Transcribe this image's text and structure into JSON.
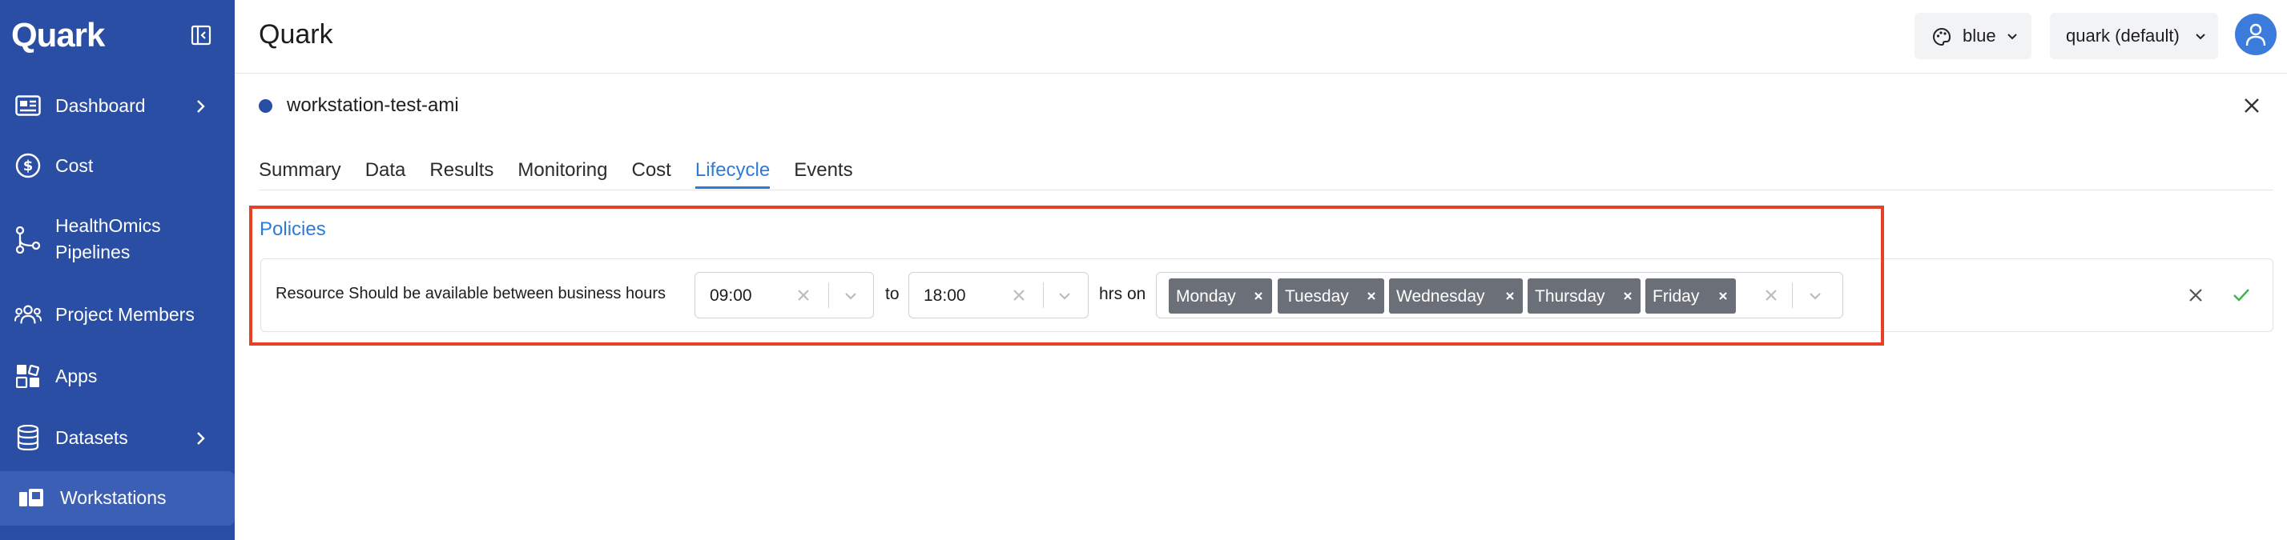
{
  "sidebar": {
    "brand": "Quark",
    "items": [
      {
        "label": "Dashboard",
        "icon": "dashboard-icon",
        "has_chevron": true
      },
      {
        "label": "Cost",
        "icon": "dollar-icon",
        "has_chevron": false
      },
      {
        "label": "HealthOmics\nPipelines",
        "icon": "pipeline-icon",
        "has_chevron": false
      },
      {
        "label": "Project Members",
        "icon": "members-icon",
        "has_chevron": false
      },
      {
        "label": "Apps",
        "icon": "apps-icon",
        "has_chevron": false
      },
      {
        "label": "Datasets",
        "icon": "database-icon",
        "has_chevron": true
      },
      {
        "label": "Workstations",
        "icon": "workstation-icon",
        "has_chevron": false,
        "active": true
      }
    ]
  },
  "header": {
    "title": "Quark",
    "theme": "blue",
    "workspace": "quark (default)"
  },
  "panel": {
    "title": "workstation-test-ami",
    "status_color": "#2a4ea3",
    "tabs": [
      {
        "label": "Summary"
      },
      {
        "label": "Data"
      },
      {
        "label": "Results"
      },
      {
        "label": "Monitoring"
      },
      {
        "label": "Cost"
      },
      {
        "label": "Lifecycle",
        "active": true
      },
      {
        "label": "Events"
      }
    ]
  },
  "policies": {
    "heading": "Policies",
    "rule_text": "Resource Should be available between business hours",
    "start_time": "09:00",
    "to_text": "to",
    "end_time": "18:00",
    "hrs_on_text": "hrs on",
    "days": [
      "Monday",
      "Tuesday",
      "Wednesday",
      "Thursday",
      "Friday"
    ]
  },
  "colors": {
    "sidebar_bg": "#2a4ea3",
    "accent": "#2d7bd8",
    "chip_bg": "#6b7078",
    "highlight": "#e64127",
    "confirm": "#3bb54a"
  }
}
